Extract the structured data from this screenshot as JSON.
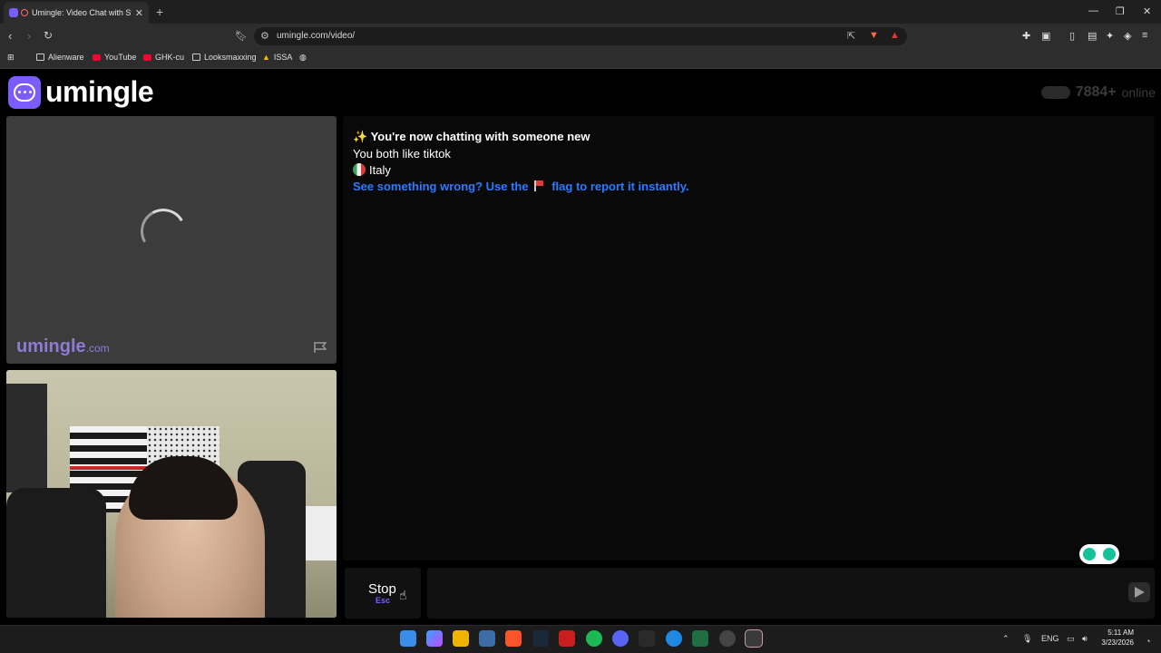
{
  "browser": {
    "tab_title": "Umingle: Video Chat with Strangers",
    "url": "umingle.com/video/",
    "bookmarks": [
      "Alienware",
      "YouTube",
      "GHK-cu",
      "Looksmaxxing",
      "ISSA"
    ]
  },
  "header": {
    "logo_text": "umingle",
    "online_count": "7884+",
    "online_label": "online"
  },
  "video": {
    "watermark_main": "umingle",
    "watermark_suffix": ".com"
  },
  "chat": {
    "messages": [
      {
        "icon": "sparkle-icon",
        "text": "You're now chatting with someone new"
      },
      {
        "text": "You both like tiktok"
      },
      {
        "icon": "italy-flag-icon",
        "text": "Italy"
      }
    ],
    "report_prefix": "See something wrong? Use the",
    "report_suffix": "flag to report it instantly.",
    "input_placeholder": ""
  },
  "controls": {
    "stop_label": "Stop",
    "stop_key": "Esc"
  },
  "taskbar": {
    "lang": "ENG",
    "time": "5:11 AM",
    "date": "3/23/2026"
  },
  "colors": {
    "brand": "#7b5cff",
    "link": "#2d7bff"
  }
}
